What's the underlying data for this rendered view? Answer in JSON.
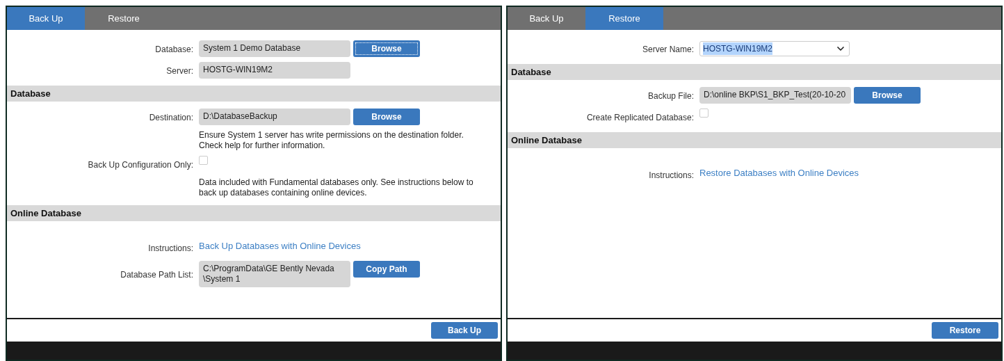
{
  "panels": [
    {
      "tabs": [
        {
          "label": "Back Up",
          "selected": true
        },
        {
          "label": "Restore",
          "selected": false
        }
      ],
      "sections": [
        {
          "rows": [
            {
              "kind": "field",
              "label": "Database:",
              "value": [
                "System 1 Demo Database"
              ],
              "button": {
                "label": "Browse",
                "focused": true
              }
            },
            {
              "kind": "field",
              "label": "Server:",
              "value": [
                "HOSTG-WIN19M2"
              ]
            }
          ]
        },
        {
          "heading": "Database",
          "rows": [
            {
              "kind": "field",
              "label": "Destination:",
              "value": [
                "D:\\DatabaseBackup"
              ],
              "button": {
                "label": "Browse",
                "focused": false
              }
            },
            {
              "kind": "note",
              "lines": [
                "Ensure System 1 server has write permissions on the destination folder.",
                "Check help for further information."
              ]
            },
            {
              "kind": "checkbox",
              "label": "Back Up Configuration Only:",
              "checked": false
            },
            {
              "kind": "note",
              "lines": [
                "Data included with Fundamental databases only. See instructions below to",
                "back up databases containing online devices."
              ]
            }
          ]
        },
        {
          "heading": "Online Database",
          "rows": [
            {
              "kind": "link",
              "label": "Instructions:",
              "link": "Back Up Databases with Online Devices"
            },
            {
              "kind": "field",
              "label": "Database Path List:",
              "value": [
                "C:\\ProgramData\\GE Bently Nevada",
                "\\System 1"
              ],
              "button": {
                "label": "Copy Path",
                "focused": false
              }
            }
          ]
        }
      ],
      "action": "Back Up"
    },
    {
      "tabs": [
        {
          "label": "Back Up",
          "selected": false
        },
        {
          "label": "Restore",
          "selected": true
        }
      ],
      "sections": [
        {
          "rows": [
            {
              "kind": "select",
              "label": "Server Name:",
              "value": "HOSTG-WIN19M2",
              "highlighted": true
            }
          ]
        },
        {
          "heading": "Database",
          "rows": [
            {
              "kind": "field",
              "label": "Backup File:",
              "value": [
                "D:\\online BKP\\S1_BKP_Test(20-10-20"
              ],
              "button": {
                "label": "Browse",
                "focused": false
              }
            },
            {
              "kind": "checkbox",
              "label": "Create Replicated Database:",
              "checked": false
            }
          ]
        },
        {
          "heading": "Online Database",
          "rows": [
            {
              "kind": "link",
              "label": "Instructions:",
              "link": "Restore Databases with Online Devices"
            }
          ]
        }
      ],
      "action": "Restore"
    }
  ]
}
